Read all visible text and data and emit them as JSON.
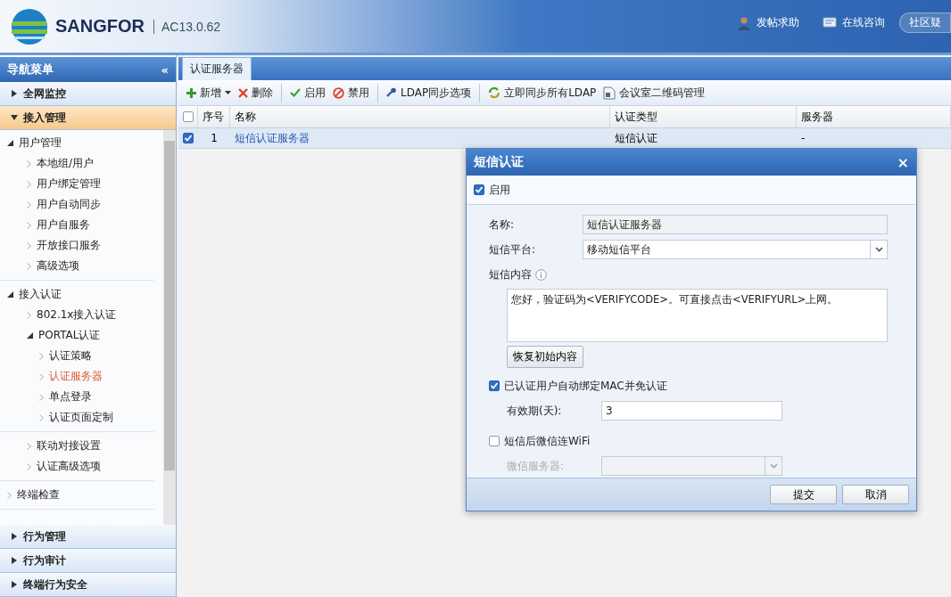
{
  "header": {
    "logo": "SANGFOR",
    "version": "AC13.0.62",
    "links": [
      {
        "label": "发帖求助"
      },
      {
        "label": "在线咨询"
      },
      {
        "label": "社区疑"
      }
    ]
  },
  "sidebar": {
    "title": "导航菜单",
    "collapse": "«",
    "sections_top": [
      {
        "label": "全网监控",
        "expanded": false
      },
      {
        "label": "接入管理",
        "expanded": true
      }
    ],
    "tree": [
      {
        "label": "用户管理",
        "expanded": true,
        "children": [
          {
            "label": "本地组/用户",
            "selected": false
          },
          {
            "label": "用户绑定管理",
            "selected": false
          },
          {
            "label": "用户自动同步",
            "selected": false
          },
          {
            "label": "用户自服务",
            "selected": false
          },
          {
            "label": "开放接口服务",
            "selected": false
          },
          {
            "label": "高级选项",
            "selected": false
          }
        ]
      },
      {
        "label": "接入认证",
        "expanded": true,
        "children": [
          {
            "label": "802.1x接入认证",
            "selected": false
          },
          {
            "label": "PORTAL认证",
            "expanded": true,
            "children": [
              {
                "label": "认证策略",
                "selected": false
              },
              {
                "label": "认证服务器",
                "selected": true
              },
              {
                "label": "单点登录",
                "selected": false
              },
              {
                "label": "认证页面定制",
                "selected": false
              }
            ]
          }
        ]
      },
      [
        {
          "label": "联动对接设置",
          "selected": false
        },
        {
          "label": "认证高级选项",
          "selected": false
        }
      ],
      {
        "label": "终端检查",
        "expanded": false
      }
    ],
    "sections_bottom": [
      {
        "label": "行为管理",
        "expanded": false
      },
      {
        "label": "行为审计",
        "expanded": false
      },
      {
        "label": "终端行为安全",
        "expanded": false
      }
    ]
  },
  "main": {
    "tabs": [
      {
        "label": "认证服务器",
        "selected": true
      }
    ],
    "toolbar": [
      [
        {
          "label": "新增",
          "dropdown": true
        },
        {
          "label": "删除",
          "dropdown": false
        }
      ],
      [
        {
          "label": "启用",
          "dropdown": false
        },
        {
          "label": "禁用",
          "dropdown": false
        }
      ],
      [
        {
          "label": "LDAP同步选项",
          "dropdown": false
        }
      ],
      [
        {
          "label": "立即同步所有LDAP",
          "dropdown": false
        },
        {
          "label": "会议室二维码管理",
          "dropdown": false
        }
      ]
    ],
    "table": {
      "all_checked": false,
      "columns": [
        "序号",
        "名称",
        "认证类型",
        "服务器"
      ],
      "rows": [
        {
          "checked": true,
          "selected": true,
          "cells": [
            "1",
            "短信认证服务器",
            "短信认证",
            "-"
          ]
        }
      ]
    }
  },
  "dialog": {
    "title": "短信认证",
    "close": "×",
    "enable": {
      "label": "启用",
      "checked": true
    },
    "name": {
      "label": "名称:",
      "value": "短信认证服务器"
    },
    "platform": {
      "label": "短信平台:",
      "value": "移动短信平台"
    },
    "content": {
      "label": "短信内容",
      "value": "您好，验证码为<VERIFYCODE>。可直接点击<VERIFYURL>上网。"
    },
    "restore": "恢复初始内容",
    "bind": {
      "label": "已认证用户自动绑定MAC并免认证",
      "checked": true
    },
    "validity": {
      "label": "有效期(天):",
      "value": "3"
    },
    "wechat": {
      "label": "短信后微信连WiFi",
      "checked": false
    },
    "wechat_server": {
      "label": "微信服务器:",
      "disabled": true
    },
    "buttons": [
      "提交",
      "取消"
    ]
  }
}
